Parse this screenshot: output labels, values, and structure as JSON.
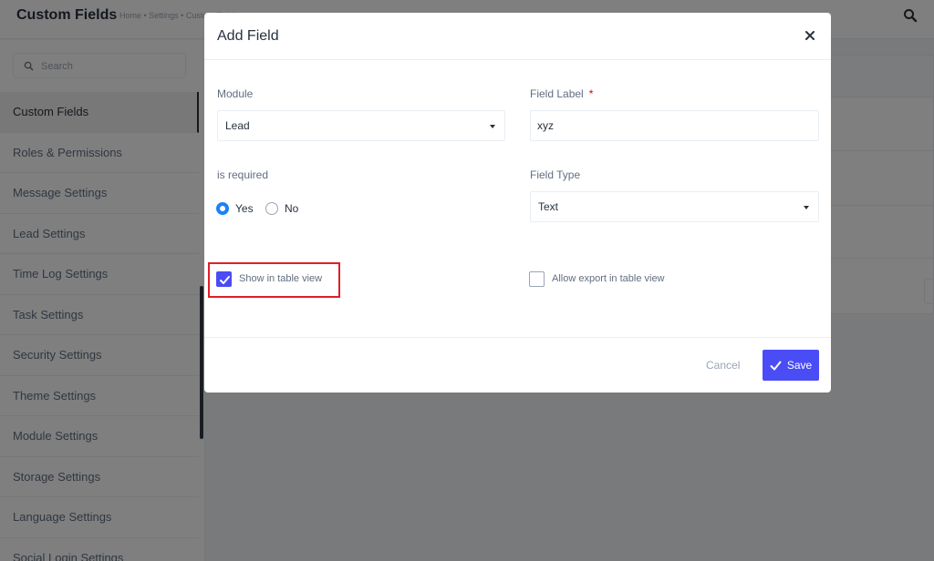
{
  "header": {
    "title": "Custom Fields",
    "breadcrumb": "Home • Settings • Custom Fields"
  },
  "sidebar": {
    "search_placeholder": "Search",
    "items": [
      {
        "label": "Custom Fields",
        "active": true
      },
      {
        "label": "Roles & Permissions"
      },
      {
        "label": "Message Settings"
      },
      {
        "label": "Lead Settings"
      },
      {
        "label": "Time Log Settings"
      },
      {
        "label": "Task Settings"
      },
      {
        "label": "Security Settings"
      },
      {
        "label": "Theme Settings"
      },
      {
        "label": "Module Settings"
      },
      {
        "label": "Storage Settings"
      },
      {
        "label": "Language Settings"
      },
      {
        "label": "Social Login Settings"
      }
    ]
  },
  "modal": {
    "title": "Add Field",
    "module_label": "Module",
    "module_value": "Lead",
    "field_label_label": "Field Label",
    "field_label_required_mark": "*",
    "field_label_value": "xyz",
    "is_required_label": "is required",
    "yes_label": "Yes",
    "no_label": "No",
    "is_required_selected": "Yes",
    "field_type_label": "Field Type",
    "field_type_value": "Text",
    "show_in_table_label": "Show in table view",
    "show_in_table_checked": true,
    "allow_export_label": "Allow export in table view",
    "allow_export_checked": false,
    "cancel_label": "Cancel",
    "save_label": "Save"
  },
  "icons": {
    "search": "search-icon",
    "close": "close-icon",
    "check": "check-icon",
    "caret": "chevron-down-icon"
  },
  "colors": {
    "primary": "#4a4cf5",
    "radio_accent": "#1d82f5",
    "highlight": "#e11e27",
    "overlay": "rgba(0,0,0,0.5)"
  }
}
